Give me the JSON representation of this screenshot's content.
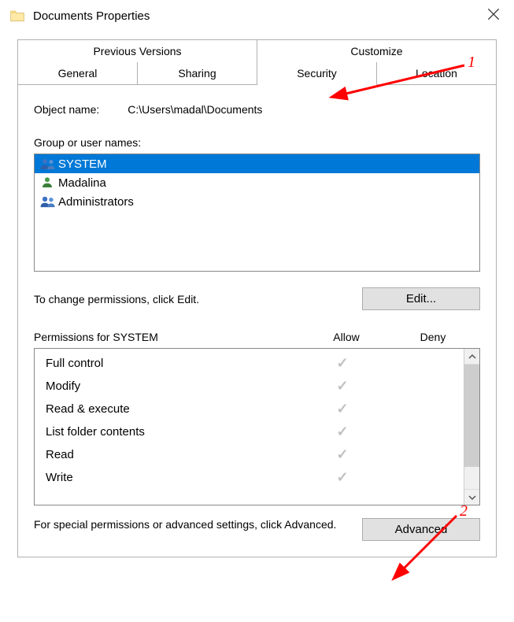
{
  "window": {
    "title": "Documents Properties"
  },
  "tabs": {
    "top": [
      "Previous Versions",
      "Customize"
    ],
    "bottom": [
      "General",
      "Sharing",
      "Security",
      "Location"
    ],
    "active": "Security"
  },
  "object": {
    "label": "Object name:",
    "path": "C:\\Users\\madal\\Documents"
  },
  "group_users": {
    "label": "Group or user names:",
    "items": [
      {
        "name": "SYSTEM",
        "icon": "users-pair-icon",
        "selected": true
      },
      {
        "name": "Madalina",
        "icon": "user-single-icon",
        "selected": false
      },
      {
        "name": "Administrators",
        "icon": "users-pair-icon",
        "selected": false
      }
    ]
  },
  "edit": {
    "text": "To change permissions, click Edit.",
    "button": "Edit..."
  },
  "permissions": {
    "header_for": "Permissions for SYSTEM",
    "allow_label": "Allow",
    "deny_label": "Deny",
    "rows": [
      {
        "name": "Full control",
        "allow": true,
        "deny": false
      },
      {
        "name": "Modify",
        "allow": true,
        "deny": false
      },
      {
        "name": "Read & execute",
        "allow": true,
        "deny": false
      },
      {
        "name": "List folder contents",
        "allow": true,
        "deny": false
      },
      {
        "name": "Read",
        "allow": true,
        "deny": false
      },
      {
        "name": "Write",
        "allow": true,
        "deny": false
      }
    ]
  },
  "advanced": {
    "text": "For special permissions or advanced settings, click Advanced.",
    "button": "Advanced"
  },
  "annotations": {
    "label1": "1",
    "label2": "2"
  }
}
